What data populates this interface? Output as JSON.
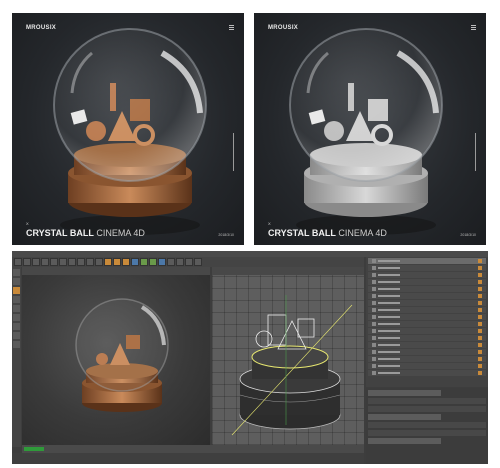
{
  "poster_left": {
    "brand": "MROUSIX",
    "x_mark": "X",
    "title_bold": "CRYSTAL BALL",
    "title_light": "CINEMA 4D",
    "date": "2018/3/10"
  },
  "poster_right": {
    "brand": "MROUSIX",
    "x_mark": "X",
    "title_bold": "CRYSTAL BALL",
    "title_light": "CINEMA 4D",
    "date": "2018/3/10"
  },
  "colors": {
    "poster_bg": "#26292d",
    "copper": "#b8764a",
    "clay": "#c8c8c8",
    "editor_bg": "#3d3d3d",
    "accent_orange": "#c98a3a",
    "timeline_green": "#2f9a3a"
  }
}
